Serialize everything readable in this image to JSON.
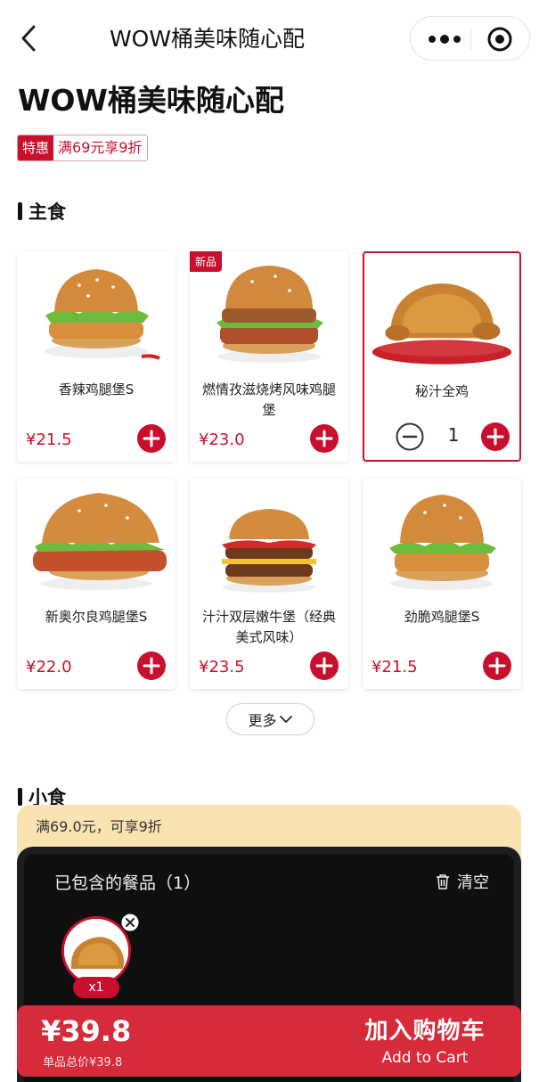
{
  "nav": {
    "title": "WOW桶美味随心配"
  },
  "page": {
    "title": "WOW桶美味随心配"
  },
  "promo": {
    "tag": "特惠",
    "text": "满69元享9折"
  },
  "sections": {
    "main": "主食",
    "snacks": "小食"
  },
  "products": [
    {
      "name": "香辣鸡腿堡S",
      "price": "¥21.5",
      "badge": ""
    },
    {
      "name": "燃情孜滋烧烤风味鸡腿堡",
      "price": "¥23.0",
      "badge": "新品"
    },
    {
      "name": "秘汁全鸡",
      "price": "",
      "badge": "",
      "quantity": "1"
    },
    {
      "name": "新奥尔良鸡腿堡S",
      "price": "¥22.0",
      "badge": ""
    },
    {
      "name": "汁汁双层嫩牛堡（经典美式风味）",
      "price": "¥23.5",
      "badge": ""
    },
    {
      "name": "劲脆鸡腿堡S",
      "price": "¥21.5",
      "badge": ""
    }
  ],
  "more_button": "更多",
  "discount_strip": {
    "text": "满69.0元，可享9折"
  },
  "cart": {
    "title": "已包含的餐品（1）",
    "clear_label": "清空",
    "items": [
      {
        "count": "x1"
      }
    ]
  },
  "bottom_bar": {
    "total": "¥39.8",
    "subtotal": "单品总价¥39.8",
    "cta_zh": "加入购物车",
    "cta_en": "Add to Cart"
  },
  "colors": {
    "accent": "#c8102e",
    "cart_bar": "#d52b3a",
    "strip": "#f9e3b3",
    "panel": "#1d1d1d"
  }
}
